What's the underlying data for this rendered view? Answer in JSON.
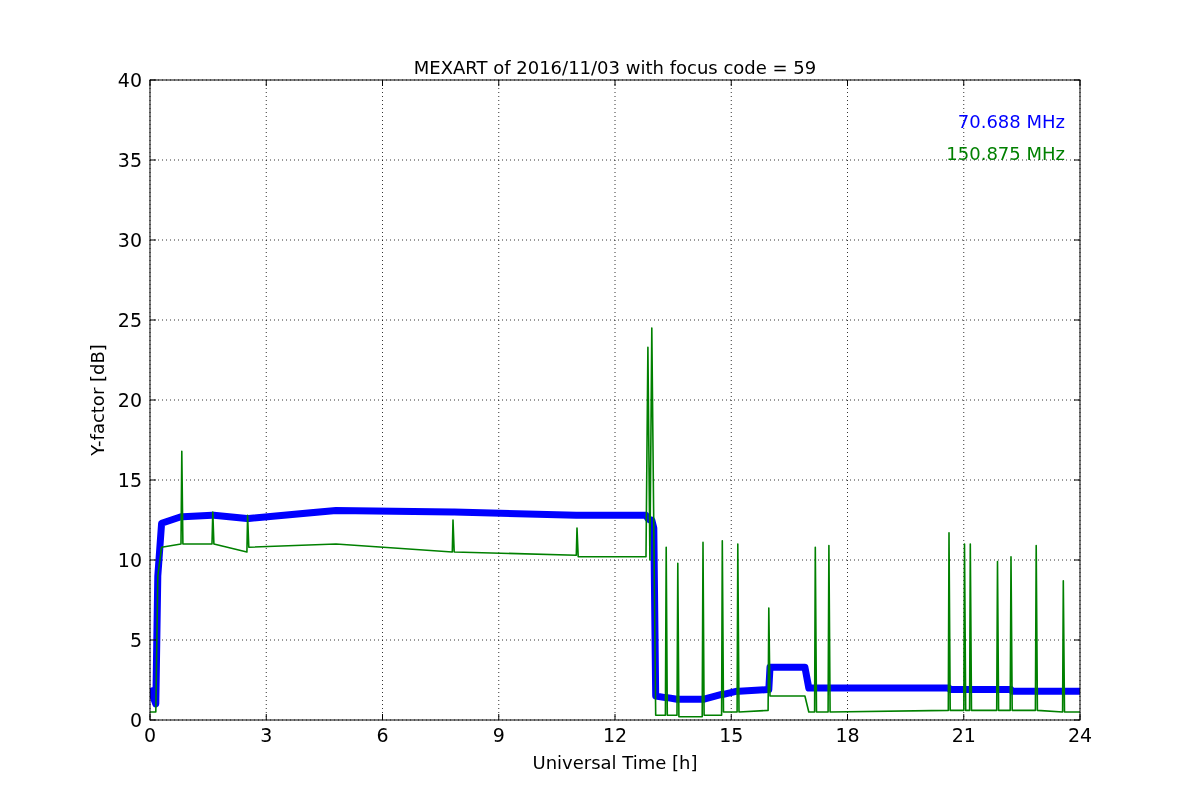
{
  "plot": {
    "chart_data": {
      "type": "line",
      "title": "MEXART of 2016/11/03 with focus code = 59",
      "xlabel": "Universal Time [h]",
      "ylabel": "Y-factor [dB]",
      "x": [
        0,
        0.15,
        0.2,
        0.3,
        0.8,
        0.82,
        0.85,
        1.6,
        1.62,
        1.65,
        2.5,
        2.52,
        2.55,
        4.8,
        7.8,
        7.82,
        7.85,
        11,
        11.02,
        11.05,
        12.8,
        12.85,
        12.9,
        12.95,
        13,
        13.05,
        13.3,
        13.32,
        13.35,
        13.6,
        13.62,
        13.65,
        14.25,
        14.27,
        14.3,
        14.75,
        14.77,
        14.8,
        15.15,
        15.17,
        15.2,
        15.95,
        15.97,
        16,
        16.9,
        17,
        17.15,
        17.17,
        17.2,
        17.5,
        17.52,
        17.55,
        20.6,
        20.62,
        20.65,
        21,
        21.02,
        21.05,
        21.15,
        21.17,
        21.2,
        21.85,
        21.87,
        21.9,
        22.2,
        22.22,
        22.25,
        22.85,
        22.87,
        22.9,
        23.55,
        23.57,
        23.6,
        24
      ],
      "series": [
        {
          "name": "70.688 MHz",
          "color": "#0000ff",
          "values": [
            2,
            1,
            9,
            12.3,
            12.7,
            12.7,
            12.7,
            12.8,
            12.8,
            12.8,
            12.6,
            12.6,
            12.6,
            13.1,
            13,
            13,
            13,
            12.8,
            12.8,
            12.8,
            12.8,
            12.6,
            12.5,
            12.5,
            12,
            1.5,
            1.4,
            1.4,
            1.4,
            1.3,
            1.3,
            1.3,
            1.3,
            1.3,
            1.3,
            1.6,
            1.6,
            1.6,
            1.8,
            1.8,
            1.8,
            1.9,
            1.9,
            3.3,
            3.3,
            2,
            2,
            2,
            2,
            2,
            2,
            2,
            2,
            2,
            1.9,
            1.9,
            1.9,
            1.9,
            1.9,
            1.9,
            1.9,
            1.9,
            1.9,
            1.9,
            1.9,
            1.9,
            1.8,
            1.8,
            1.8,
            1.8,
            1.8,
            1.8,
            1.8,
            1.8
          ]
        },
        {
          "name": "150.875 MHz",
          "color": "#008000",
          "values": [
            0.5,
            0.5,
            9,
            10.8,
            11,
            16.8,
            11,
            11,
            13,
            11,
            10.5,
            12.8,
            10.8,
            11,
            10.5,
            12.5,
            10.5,
            10.3,
            12,
            10.2,
            10.2,
            23.3,
            10,
            24.5,
            12,
            0.3,
            0.3,
            10.8,
            0.3,
            0.3,
            9.8,
            0.2,
            0.2,
            11.1,
            0.3,
            0.3,
            11.2,
            0.5,
            0.5,
            11,
            0.5,
            0.6,
            7,
            1.5,
            1.5,
            0.5,
            0.5,
            10.8,
            0.5,
            0.5,
            10.9,
            0.5,
            0.6,
            11.7,
            0.6,
            0.6,
            11,
            0.6,
            0.6,
            11,
            0.6,
            0.6,
            9.9,
            0.6,
            0.6,
            10.2,
            0.6,
            0.6,
            10.9,
            0.6,
            0.5,
            8.7,
            0.5,
            0.5
          ]
        }
      ],
      "grid": true,
      "xlim": [
        0,
        24
      ],
      "ylim": [
        0,
        40
      ],
      "xticks": [
        0,
        3,
        6,
        9,
        12,
        15,
        18,
        21,
        24
      ],
      "yticks": [
        0,
        5,
        10,
        15,
        20,
        25,
        30,
        35,
        40
      ]
    }
  }
}
